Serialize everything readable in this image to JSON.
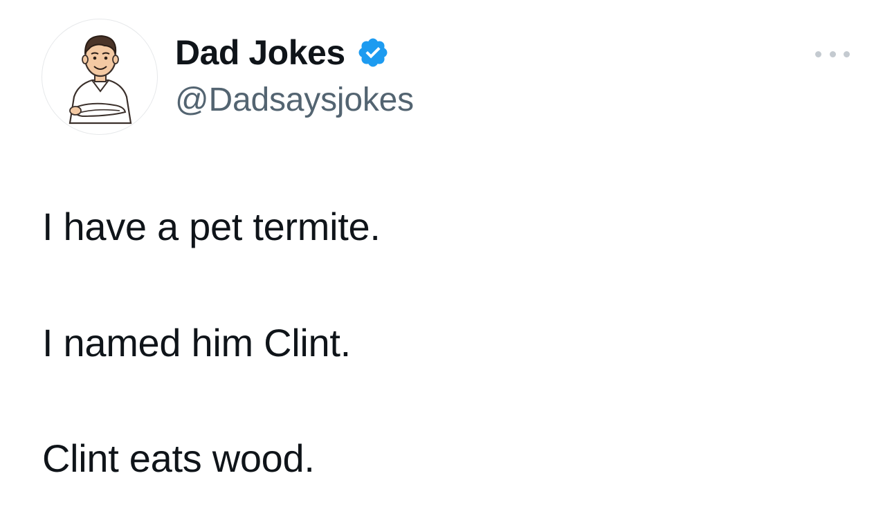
{
  "author": {
    "display_name": "Dad Jokes",
    "handle": "@Dadsaysjokes",
    "verified": true,
    "verified_badge_color": "#1d9bf0",
    "avatar_icon": "cartoon-man-arms-crossed-icon"
  },
  "tweet": {
    "lines": [
      "I have a pet termite.",
      "I named him Clint.",
      "Clint eats wood."
    ]
  },
  "menu": {
    "icon": "more-options-icon"
  },
  "colors": {
    "text_primary": "#0f1419",
    "text_secondary": "#536471",
    "background": "#ffffff"
  }
}
